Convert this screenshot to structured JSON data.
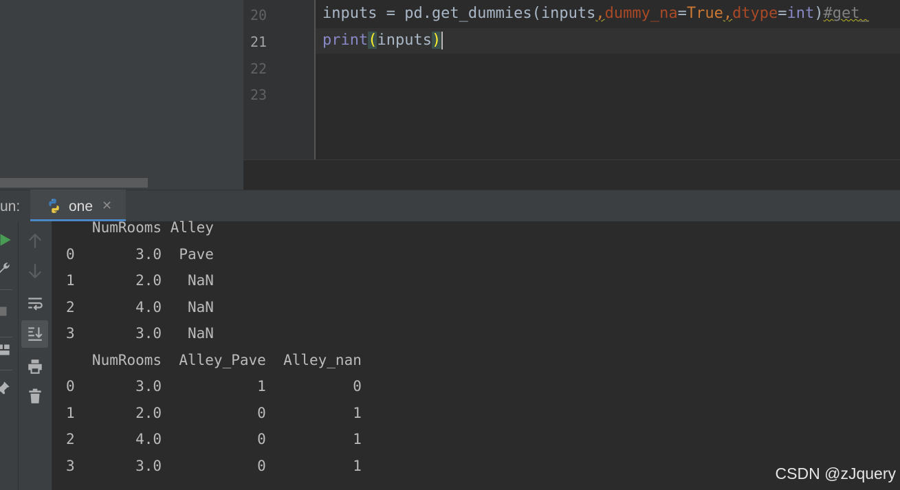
{
  "editor": {
    "line_numbers": [
      "20",
      "21",
      "22",
      "23"
    ],
    "active_line": "21",
    "line20": {
      "t1": "inputs = pd.get_dummies(inputs",
      "t2": ",",
      "t3": "dummy_na",
      "t4": "=",
      "t5": "True",
      "t6": ",",
      "t7": "dtype",
      "t8": "=",
      "t9": "int",
      "t10": ")",
      "t11": "#get_"
    },
    "line21": {
      "func": "print",
      "open_paren": "(",
      "arg": "inputs",
      "close_paren": ")"
    }
  },
  "run_window": {
    "label": "un:",
    "tab_label": "one",
    "tab_close": "✕"
  },
  "toolbar_icons": {
    "strip1": [
      "run-icon",
      "wrench-icon",
      "stop-icon",
      "layout-icon",
      "pin-icon"
    ],
    "strip2": [
      "up-arrow-icon",
      "down-arrow-icon",
      "soft-wrap-icon",
      "scroll-to-end-icon",
      "print-icon",
      "trash-icon"
    ]
  },
  "console_output": [
    "   NumRooms Alley",
    "0       3.0  Pave",
    "1       2.0   NaN",
    "2       4.0   NaN",
    "3       3.0   NaN",
    "   NumRooms  Alley_Pave  Alley_nan",
    "0       3.0           1          0",
    "1       2.0           0          1",
    "2       4.0           0          1",
    "3       3.0           0          1"
  ],
  "watermark": "CSDN @zJquery",
  "colors": {
    "background": "#2b2b2b",
    "panel": "#3c3f41",
    "keyword": "#cc7832",
    "param": "#aa4926",
    "builtin": "#8888c6",
    "paren_highlight": "#ffef28",
    "run_green": "#499c54"
  }
}
